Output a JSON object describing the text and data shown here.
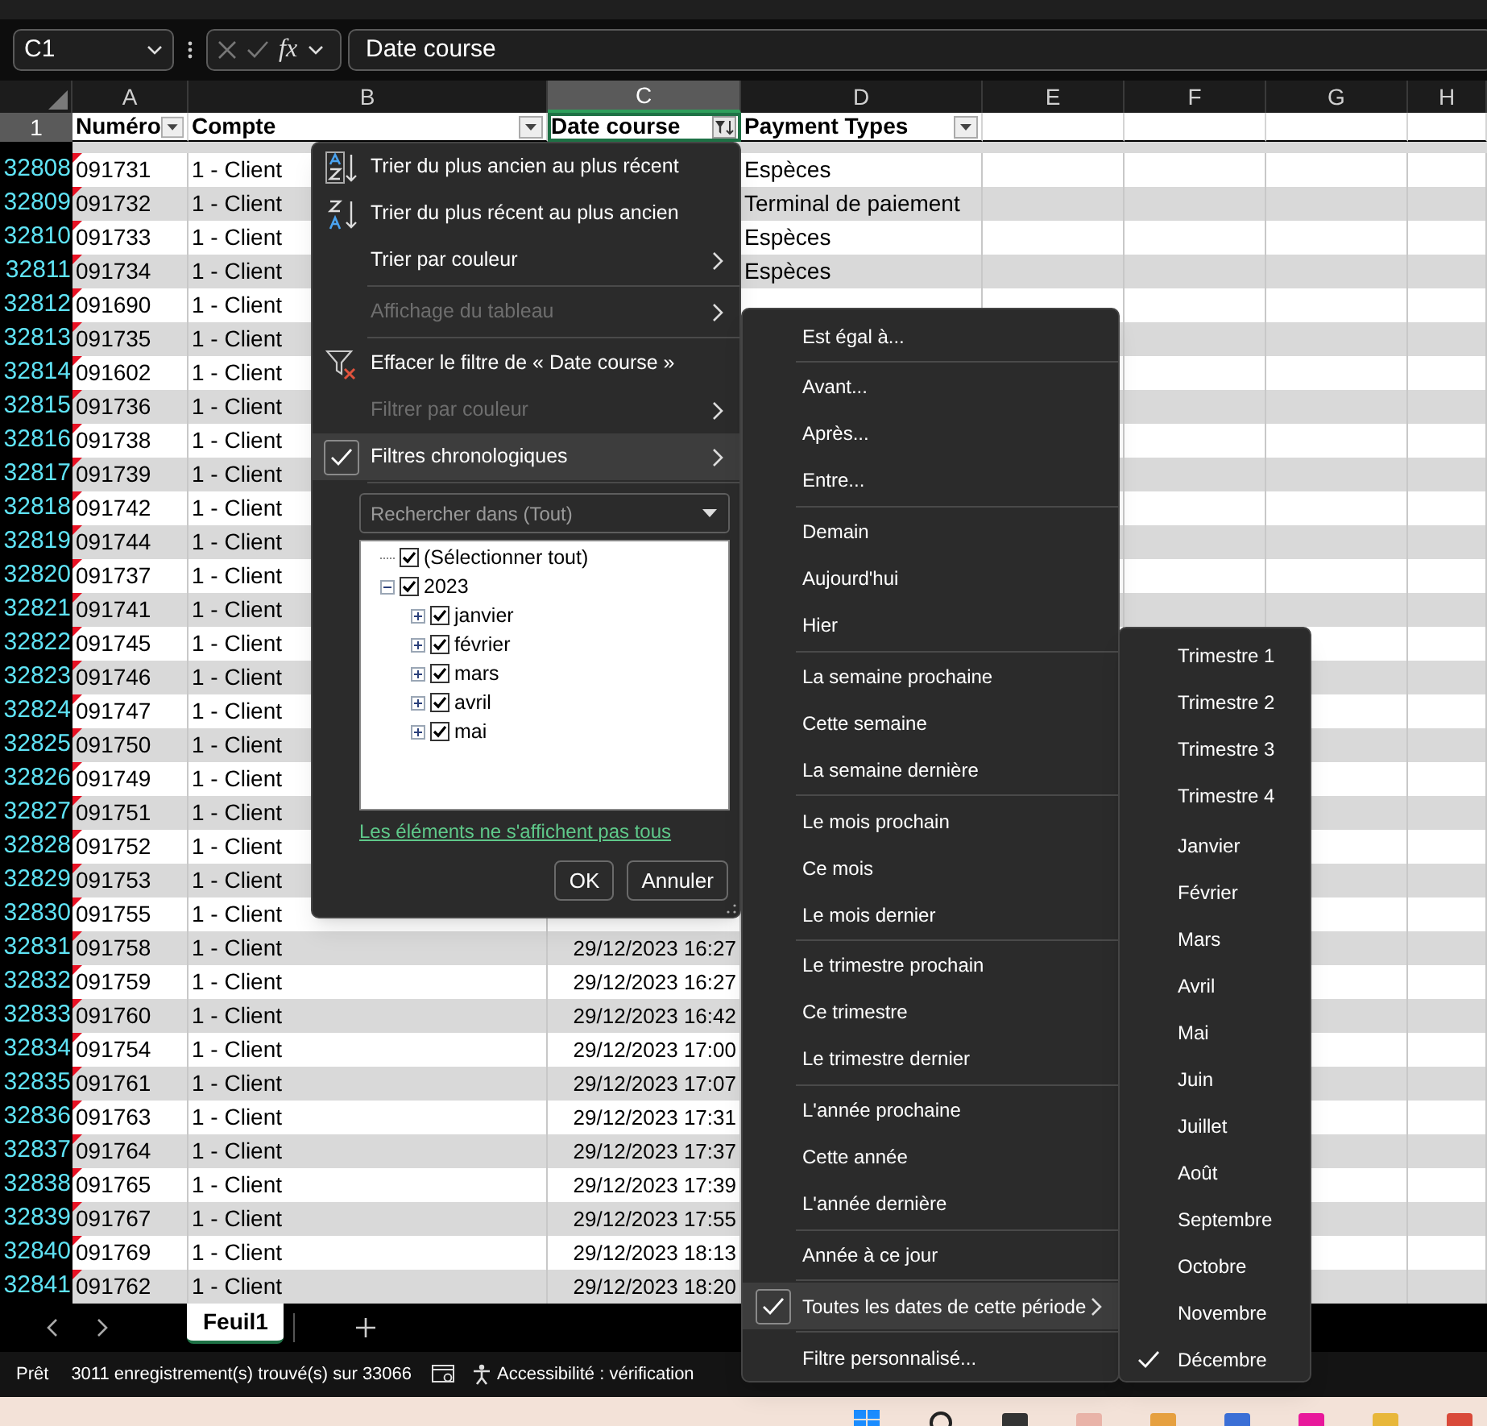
{
  "formula_bar": {
    "name_box": "C1",
    "function_label": "fx",
    "formula": "Date course"
  },
  "sheet": {
    "columns": [
      {
        "letter": "A",
        "selected": false
      },
      {
        "letter": "B",
        "selected": false
      },
      {
        "letter": "C",
        "selected": true
      },
      {
        "letter": "D",
        "selected": false
      },
      {
        "letter": "E",
        "selected": false
      },
      {
        "letter": "F",
        "selected": false
      },
      {
        "letter": "G",
        "selected": false
      },
      {
        "letter": "H",
        "selected": false
      }
    ],
    "header_row": {
      "number": "1",
      "selected": true,
      "cells": [
        {
          "label": "Numéro",
          "filter_applied": false
        },
        {
          "label": "Compte",
          "filter_applied": false
        },
        {
          "label": "Date course",
          "filter_applied": true
        },
        {
          "label": "Payment Types",
          "filter_applied": false
        }
      ]
    },
    "rows": [
      {
        "number": "32808",
        "numero": "091731",
        "compte": "1 - Client",
        "payment_type": "Espèces",
        "note": true
      },
      {
        "number": "32809",
        "numero": "091732",
        "compte": "1 - Client",
        "payment_type": "Terminal de paiement",
        "note": true
      },
      {
        "number": "32810",
        "numero": "091733",
        "compte": "1 - Client",
        "payment_type": "Espèces",
        "note": true
      },
      {
        "number": "32811",
        "numero": "091734",
        "compte": "1 - Client",
        "payment_type": "Espèces",
        "note": true
      },
      {
        "number": "32812",
        "numero": "091690",
        "compte": "1 - Client",
        "note": true
      },
      {
        "number": "32813",
        "numero": "091735",
        "compte": "1 - Client",
        "note": true
      },
      {
        "number": "32814",
        "numero": "091602",
        "compte": "1 - Client",
        "note": true
      },
      {
        "number": "32815",
        "numero": "091736",
        "compte": "1 - Client",
        "note": true
      },
      {
        "number": "32816",
        "numero": "091738",
        "compte": "1 - Client",
        "note": true
      },
      {
        "number": "32817",
        "numero": "091739",
        "compte": "1 - Client",
        "note": true
      },
      {
        "number": "32818",
        "numero": "091742",
        "compte": "1 - Client",
        "note": true
      },
      {
        "number": "32819",
        "numero": "091744",
        "compte": "1 - Client",
        "note": true
      },
      {
        "number": "32820",
        "numero": "091737",
        "compte": "1 - Client",
        "note": true
      },
      {
        "number": "32821",
        "numero": "091741",
        "compte": "1 - Client",
        "note": true
      },
      {
        "number": "32822",
        "numero": "091745",
        "compte": "1 - Client",
        "note": true
      },
      {
        "number": "32823",
        "numero": "091746",
        "compte": "1 - Client",
        "note": true
      },
      {
        "number": "32824",
        "numero": "091747",
        "compte": "1 - Client",
        "note": true
      },
      {
        "number": "32825",
        "numero": "091750",
        "compte": "1 - Client",
        "note": true
      },
      {
        "number": "32826",
        "numero": "091749",
        "compte": "1 - Client",
        "note": true
      },
      {
        "number": "32827",
        "numero": "091751",
        "compte": "1 - Client",
        "note": true
      },
      {
        "number": "32828",
        "numero": "091752",
        "compte": "1 - Client",
        "note": true
      },
      {
        "number": "32829",
        "numero": "091753",
        "compte": "1 - Client",
        "note": true
      },
      {
        "number": "32830",
        "numero": "091755",
        "compte": "1 - Client",
        "note": true
      },
      {
        "number": "32831",
        "numero": "091758",
        "compte": "1 - Client",
        "date_course": "29/12/2023 16:27",
        "note": true
      },
      {
        "number": "32832",
        "numero": "091759",
        "compte": "1 - Client",
        "date_course": "29/12/2023 16:27",
        "note": true
      },
      {
        "number": "32833",
        "numero": "091760",
        "compte": "1 - Client",
        "date_course": "29/12/2023 16:42",
        "note": true
      },
      {
        "number": "32834",
        "numero": "091754",
        "compte": "1 - Client",
        "date_course": "29/12/2023 17:00",
        "note": true
      },
      {
        "number": "32835",
        "numero": "091761",
        "compte": "1 - Client",
        "date_course": "29/12/2023 17:07",
        "note": true
      },
      {
        "number": "32836",
        "numero": "091763",
        "compte": "1 - Client",
        "date_course": "29/12/2023 17:31",
        "note": true
      },
      {
        "number": "32837",
        "numero": "091764",
        "compte": "1 - Client",
        "date_course": "29/12/2023 17:37",
        "note": true
      },
      {
        "number": "32838",
        "numero": "091765",
        "compte": "1 - Client",
        "date_course": "29/12/2023 17:39",
        "note": true
      },
      {
        "number": "32839",
        "numero": "091767",
        "compte": "1 - Client",
        "date_course": "29/12/2023 17:55",
        "note": true
      },
      {
        "number": "32840",
        "numero": "091769",
        "compte": "1 - Client",
        "date_course": "29/12/2023 18:13",
        "note": true
      },
      {
        "number": "32841",
        "numero": "091762",
        "compte": "1 - Client",
        "date_course": "29/12/2023 18:20",
        "note": true
      }
    ]
  },
  "filter_menu": {
    "groups": [
      [
        {
          "kind": "sort_ascending",
          "label": "Trier du plus ancien au plus récent",
          "disabled": false,
          "checked": false,
          "has_submenu": false,
          "selected": false
        },
        {
          "kind": "sort_descending",
          "label": "Trier du plus récent au plus ancien",
          "disabled": false,
          "checked": false,
          "has_submenu": false,
          "selected": false
        },
        {
          "kind": "item",
          "label": "Trier par couleur",
          "disabled": false,
          "checked": false,
          "has_submenu": true,
          "selected": false
        }
      ],
      [
        {
          "kind": "item",
          "label": "Affichage du tableau",
          "disabled": true,
          "checked": false,
          "has_submenu": true,
          "selected": false
        }
      ],
      [
        {
          "kind": "clear_filter",
          "label": "Effacer le filtre de « Date course »",
          "disabled": false,
          "checked": false,
          "has_submenu": false,
          "selected": false
        },
        {
          "kind": "item",
          "label": "Filtrer par couleur",
          "disabled": true,
          "checked": false,
          "has_submenu": true,
          "selected": false
        },
        {
          "kind": "item",
          "label": "Filtres chronologiques",
          "disabled": false,
          "checked": true,
          "has_submenu": true,
          "selected": true
        }
      ]
    ],
    "search": {
      "placeholder": "Rechercher dans (Tout)"
    },
    "tree": [
      {
        "label": "(Sélectionner tout)",
        "checked": true
      },
      {
        "label": "2023",
        "checked": true,
        "expanded": true,
        "children": [
          {
            "label": "janvier",
            "checked": true,
            "expanded": false
          },
          {
            "label": "février",
            "checked": true,
            "expanded": false
          },
          {
            "label": "mars",
            "checked": true,
            "expanded": false
          },
          {
            "label": "avril",
            "checked": true,
            "expanded": false
          },
          {
            "label": "mai",
            "checked": true,
            "expanded": false
          }
        ]
      }
    ],
    "notice_link": "Les éléments ne s'affichent pas tous",
    "buttons": [
      "OK",
      "Annuler"
    ]
  },
  "date_filters_menu": {
    "groups": [
      [
        {
          "label": "Est égal à...",
          "checked": false,
          "has_submenu": false,
          "selected": false
        }
      ],
      [
        {
          "label": "Avant...",
          "checked": false,
          "has_submenu": false,
          "selected": false
        },
        {
          "label": "Après...",
          "checked": false,
          "has_submenu": false,
          "selected": false
        },
        {
          "label": "Entre...",
          "checked": false,
          "has_submenu": false,
          "selected": false
        }
      ],
      [
        {
          "label": "Demain",
          "checked": false,
          "has_submenu": false,
          "selected": false
        },
        {
          "label": "Aujourd'hui",
          "checked": false,
          "has_submenu": false,
          "selected": false
        },
        {
          "label": "Hier",
          "checked": false,
          "has_submenu": false,
          "selected": false
        }
      ],
      [
        {
          "label": "La semaine prochaine",
          "checked": false,
          "has_submenu": false,
          "selected": false
        },
        {
          "label": "Cette semaine",
          "checked": false,
          "has_submenu": false,
          "selected": false
        },
        {
          "label": "La semaine dernière",
          "checked": false,
          "has_submenu": false,
          "selected": false
        }
      ],
      [
        {
          "label": "Le mois prochain",
          "checked": false,
          "has_submenu": false,
          "selected": false
        },
        {
          "label": "Ce mois",
          "checked": false,
          "has_submenu": false,
          "selected": false
        },
        {
          "label": "Le mois dernier",
          "checked": false,
          "has_submenu": false,
          "selected": false
        }
      ],
      [
        {
          "label": "Le trimestre prochain",
          "checked": false,
          "has_submenu": false,
          "selected": false
        },
        {
          "label": "Ce trimestre",
          "checked": false,
          "has_submenu": false,
          "selected": false
        },
        {
          "label": "Le trimestre dernier",
          "checked": false,
          "has_submenu": false,
          "selected": false
        }
      ],
      [
        {
          "label": "L'année prochaine",
          "checked": false,
          "has_submenu": false,
          "selected": false
        },
        {
          "label": "Cette année",
          "checked": false,
          "has_submenu": false,
          "selected": false
        },
        {
          "label": "L'année dernière",
          "checked": false,
          "has_submenu": false,
          "selected": false
        }
      ],
      [
        {
          "label": "Année à ce jour",
          "checked": false,
          "has_submenu": false,
          "selected": false
        }
      ],
      [
        {
          "label": "Toutes les dates de cette période",
          "checked": true,
          "has_submenu": true,
          "selected": true
        }
      ],
      [
        {
          "label": "Filtre personnalisé...",
          "checked": false,
          "has_submenu": false,
          "selected": false
        }
      ]
    ]
  },
  "period_menu": {
    "groups": [
      [
        {
          "label": "Trimestre 1",
          "checked": false
        },
        {
          "label": "Trimestre 2",
          "checked": false
        },
        {
          "label": "Trimestre 3",
          "checked": false
        },
        {
          "label": "Trimestre 4",
          "checked": false
        }
      ],
      [
        {
          "label": "Janvier",
          "checked": false
        },
        {
          "label": "Février",
          "checked": false
        },
        {
          "label": "Mars",
          "checked": false
        },
        {
          "label": "Avril",
          "checked": false
        },
        {
          "label": "Mai",
          "checked": false
        },
        {
          "label": "Juin",
          "checked": false
        },
        {
          "label": "Juillet",
          "checked": false
        },
        {
          "label": "Août",
          "checked": false
        },
        {
          "label": "Septembre",
          "checked": false
        },
        {
          "label": "Octobre",
          "checked": false
        },
        {
          "label": "Novembre",
          "checked": false
        },
        {
          "label": "Décembre",
          "checked": true
        }
      ]
    ]
  },
  "sheet_tabs": [
    {
      "label": "Feuil1",
      "selected": true
    }
  ],
  "status_bar": {
    "mode": "Prêt",
    "records": "3011 enregistrement(s) trouvé(s) sur 33066",
    "accessibility": "Accessibilité : vérification"
  }
}
